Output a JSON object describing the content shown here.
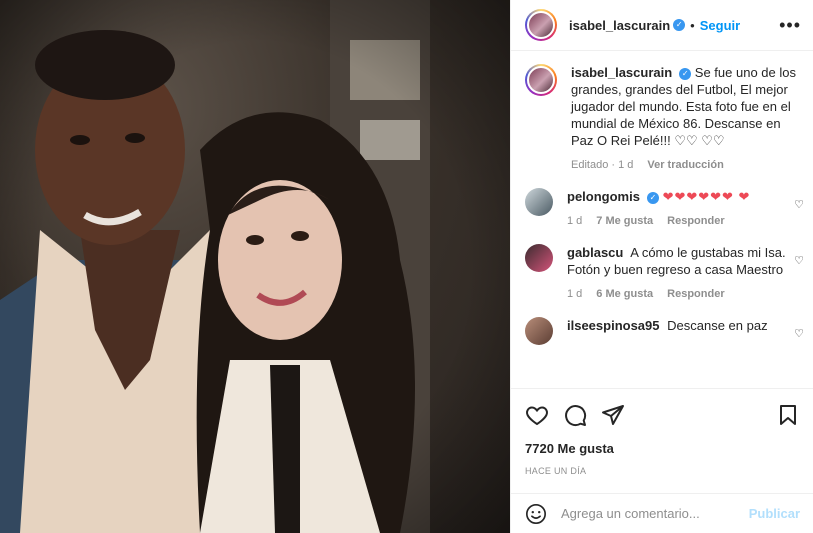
{
  "header": {
    "username": "isabel_lascurain",
    "follow_label": "Seguir",
    "separator": "•",
    "more_label": "•••"
  },
  "caption": {
    "username": "isabel_lascurain",
    "text": "Se fue uno de los grandes, grandes del Futbol, El mejor jugador del mundo. Esta foto fue en el mundial de México 86. Descanse en Paz O Rei Pelé!!! ♡♡ ♡♡",
    "edited": "Editado · 1 d",
    "translate": "Ver traducción"
  },
  "comments": [
    {
      "username": "pelongomis",
      "verified": true,
      "text": "❤❤❤❤❤❤ ❤",
      "time": "1 d",
      "likes": "7 Me gusta",
      "reply": "Responder"
    },
    {
      "username": "gablascu",
      "verified": false,
      "text": "A cómo le gustabas mi Isa. Fotón y buen regreso a casa Maestro",
      "time": "1 d",
      "likes": "6 Me gusta",
      "reply": "Responder"
    },
    {
      "username": "ilseespinosa95",
      "verified": false,
      "text": "Descanse en paz"
    }
  ],
  "stats": {
    "likes": "7720 Me gusta",
    "posted": "HACE UN DÍA"
  },
  "composer": {
    "placeholder": "Agrega un comentario...",
    "publish_label": "Publicar"
  },
  "colors": {
    "link": "#0095f6",
    "verified": "#3897f0",
    "heart_red": "#ed4956",
    "muted": "#8e8e8e"
  }
}
